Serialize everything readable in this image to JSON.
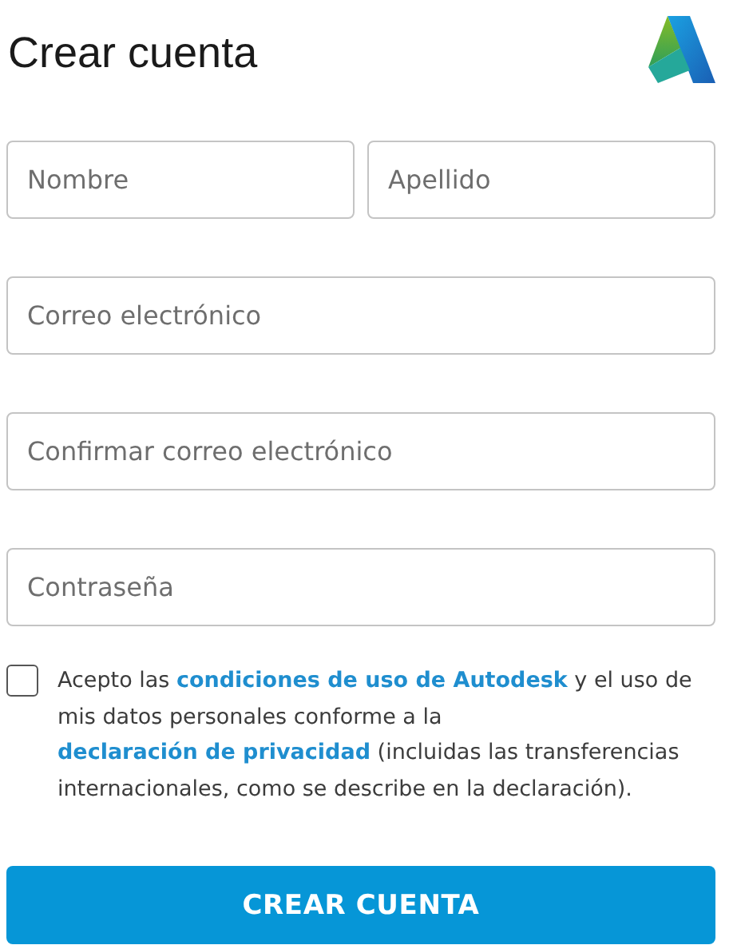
{
  "title": "Crear cuenta",
  "name_fields": [
    {
      "placeholder": "Nombre"
    },
    {
      "placeholder": "Apellido"
    }
  ],
  "fields": [
    {
      "placeholder": "Correo electrónico"
    },
    {
      "placeholder": "Confirmar correo electrónico"
    },
    {
      "placeholder": "Contraseña"
    }
  ],
  "consent": {
    "checked": false,
    "parts": [
      {
        "kind": "text",
        "text": "Acepto las"
      },
      {
        "kind": "link",
        "text": "condiciones de uso de Autodesk"
      },
      {
        "kind": "text",
        "text": "y el uso de mis datos personales conforme a la"
      },
      {
        "kind": "link",
        "text": "declaración de privacidad"
      },
      {
        "kind": "text",
        "text": "(incluidas las transferencias internacionales, como se describe en la declaración)."
      }
    ]
  },
  "submit": "CREAR CUENTA"
}
